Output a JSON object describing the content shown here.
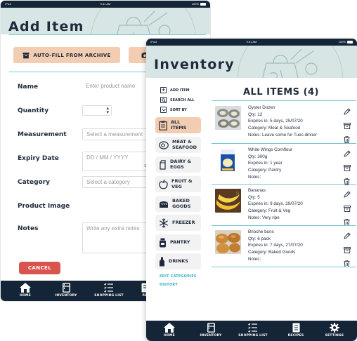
{
  "status_bar": {
    "carrier": "iPad",
    "time": "9:41 AM",
    "battery": "100%"
  },
  "add_item": {
    "title": "Add Item",
    "autofill_label": "AUTO-FILL FROM ARCHIVE",
    "fields": {
      "name": {
        "label": "Name",
        "placeholder": "Enter product name"
      },
      "quantity": {
        "label": "Quantity"
      },
      "measurement": {
        "label": "Measurement",
        "placeholder": "Select a measurement"
      },
      "expiry": {
        "label": "Expiry Date",
        "placeholder": "DD / MM / YYYY",
        "side_note": "S"
      },
      "category": {
        "label": "Category",
        "placeholder": "Select a category"
      },
      "image": {
        "label": "Product Image"
      },
      "notes": {
        "label": "Notes",
        "placeholder": "Write any extra notes"
      }
    },
    "cancel_label": "CANCEL"
  },
  "inventory": {
    "title": "Inventory",
    "actions": [
      {
        "icon": "plus-icon",
        "label": "ADD ITEM"
      },
      {
        "icon": "search-icon",
        "label": "SEARCH ALL"
      },
      {
        "icon": "chevron-down-icon",
        "label": "SORT BY"
      }
    ],
    "categories": [
      {
        "label_1": "ALL",
        "label_2": "ITEMS",
        "icon": "clipboard-icon",
        "active": true
      },
      {
        "label_1": "MEAT &",
        "label_2": "SEAFOOD",
        "icon": "meat-icon"
      },
      {
        "label_1": "DAIRY &",
        "label_2": "EGGS",
        "icon": "milk-carton-icon"
      },
      {
        "label_1": "FRUIT &",
        "label_2": "VEG",
        "icon": "apple-icon"
      },
      {
        "label_1": "BAKED",
        "label_2": "GOODS",
        "icon": "bread-icon"
      },
      {
        "label_1": "FREEZER",
        "label_2": "",
        "icon": "snowflake-icon"
      },
      {
        "label_1": "PANTRY",
        "label_2": "",
        "icon": "jar-icon"
      },
      {
        "label_1": "DRINKS",
        "label_2": "",
        "icon": "bottle-icon"
      }
    ],
    "links": {
      "edit_categories": "EDIT CATEGORIES",
      "history": "HISTORY"
    },
    "list_title": "ALL ITEMS (4)",
    "items": [
      {
        "name": "Oyster Dozen",
        "qty": "Qty: 12",
        "expires": "Expires in: 5 days, 25/07/20",
        "category": "Category: Meat & Seafood",
        "notes": "Notes: Leave some for Tues dinner"
      },
      {
        "name": "White Wings Cornflour",
        "qty": "Qty: 300g",
        "expires": "Expires in: 1 year",
        "category": "Category: Pantry",
        "notes": "Notes:"
      },
      {
        "name": "Bananas",
        "qty": "Qty: 5",
        "expires": "Expires in: 9 days, 29/07/20",
        "category": "Category: Fruit & Veg",
        "notes": "Notes: Very ripe"
      },
      {
        "name": "Brioche buns",
        "qty": "Qty: 6 pack",
        "expires": "Expires in: 7 days, 27/07/20",
        "category": "Category: Baked Goods",
        "notes": "Notes:"
      }
    ]
  },
  "tabs": [
    {
      "label": "HOME",
      "icon": "home-icon"
    },
    {
      "label": "INVENTORY",
      "icon": "fridge-icon"
    },
    {
      "label": "SHOPPING LIST",
      "icon": "checklist-icon"
    },
    {
      "label": "RECIPES",
      "icon": "recipe-book-icon"
    },
    {
      "label": "SETTINGS",
      "icon": "gear-icon"
    }
  ],
  "back_tabs_partial": {
    "last_label": "RE"
  },
  "colors": {
    "navy": "#152538",
    "header_teal": "#d7e6e4",
    "accent_peach": "#f2cdb1",
    "teal_line": "#76c8cf",
    "cancel_red": "#d9544f",
    "link_teal": "#32b3c4"
  }
}
